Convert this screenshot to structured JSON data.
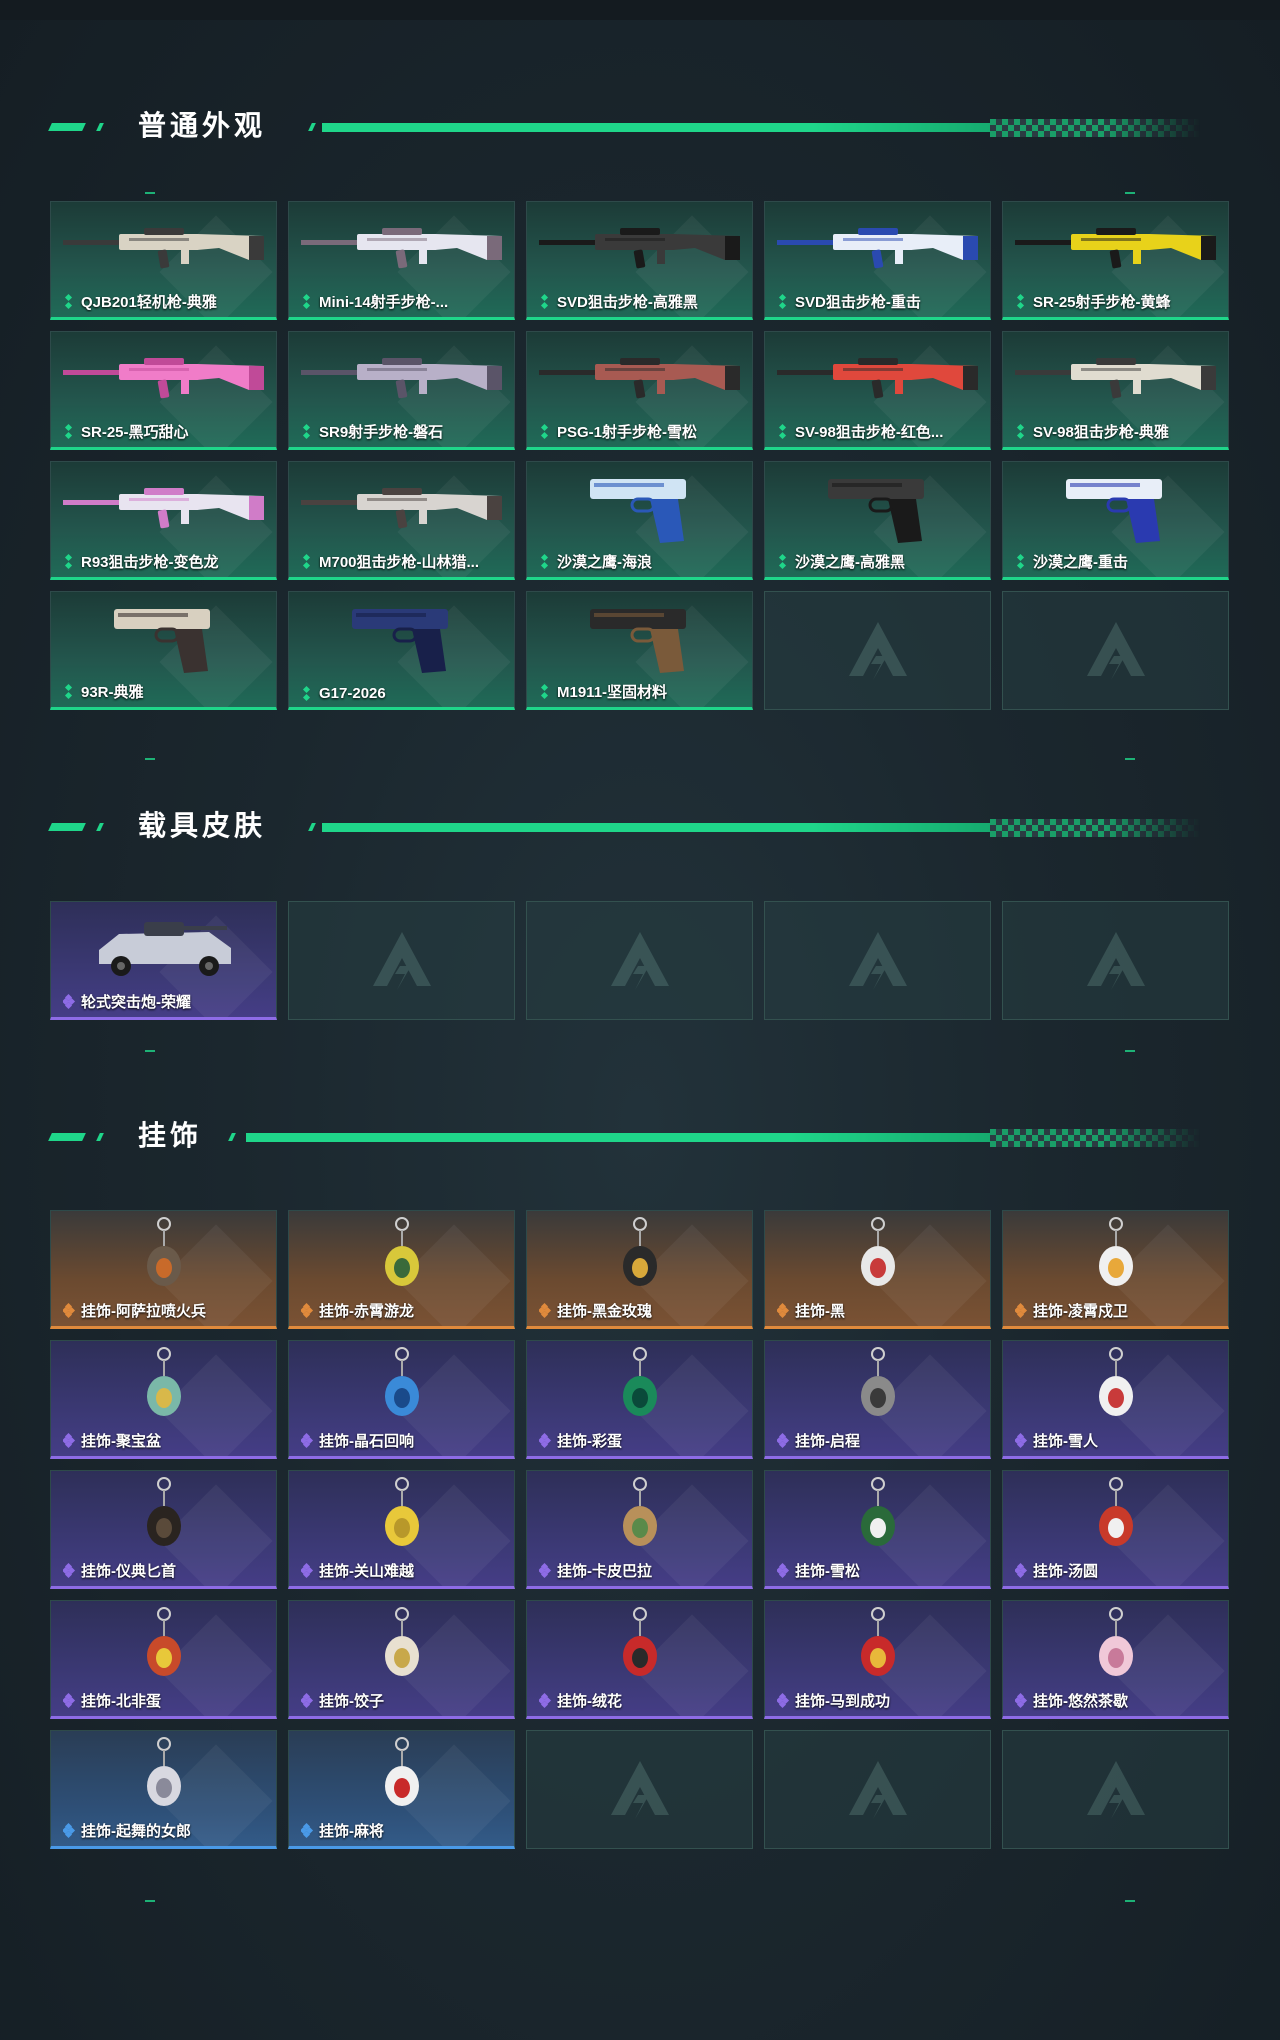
{
  "colors": {
    "accent": "#1fd68a",
    "rarity_green": "#1fd68a",
    "rarity_purple": "#8e6ce6",
    "rarity_orange": "#e08a3c",
    "rarity_blue": "#4a9ae8"
  },
  "sections": [
    {
      "title": "普通外观",
      "items": [
        {
          "label": "QJB201轻机枪-典雅",
          "rarity": "green",
          "icon": "light-machine-gun-icon",
          "art": "rifle",
          "c1": "#d9d3c4",
          "c2": "#3a3a3a"
        },
        {
          "label": "Mini-14射手步枪-...",
          "rarity": "green",
          "icon": "marksman-rifle-icon",
          "art": "rifle",
          "c1": "#e6e6f0",
          "c2": "#7a6a7a"
        },
        {
          "label": "SVD狙击步枪-高雅黑",
          "rarity": "green",
          "icon": "sniper-rifle-icon",
          "art": "rifle",
          "c1": "#3a3a3a",
          "c2": "#1a1a1a"
        },
        {
          "label": "SVD狙击步枪-重击",
          "rarity": "green",
          "icon": "sniper-rifle-icon",
          "art": "rifle",
          "c1": "#e8eef8",
          "c2": "#2a4ab0"
        },
        {
          "label": "SR-25射手步枪-黄蜂",
          "rarity": "green",
          "icon": "marksman-rifle-icon",
          "art": "rifle",
          "c1": "#e8d21a",
          "c2": "#1a1a1a"
        },
        {
          "label": "SR-25-黑巧甜心",
          "rarity": "green",
          "icon": "marksman-rifle-icon",
          "art": "rifle",
          "c1": "#f07cc8",
          "c2": "#c04a98"
        },
        {
          "label": "SR9射手步枪-磐石",
          "rarity": "green",
          "icon": "marksman-rifle-icon",
          "art": "rifle",
          "c1": "#b8b0c8",
          "c2": "#5a5468"
        },
        {
          "label": "PSG-1射手步枪-雪松",
          "rarity": "green",
          "icon": "marksman-rifle-icon",
          "art": "rifle",
          "c1": "#a85a52",
          "c2": "#2a2a2a"
        },
        {
          "label": "SV-98狙击步枪-红色...",
          "rarity": "green",
          "icon": "sniper-rifle-icon",
          "art": "rifle",
          "c1": "#e0483c",
          "c2": "#2a2a2a"
        },
        {
          "label": "SV-98狙击步枪-典雅",
          "rarity": "green",
          "icon": "sniper-rifle-icon",
          "art": "rifle",
          "c1": "#e0dcd0",
          "c2": "#3a3a3a"
        },
        {
          "label": "R93狙击步枪-变色龙",
          "rarity": "green",
          "icon": "sniper-rifle-icon",
          "art": "rifle",
          "c1": "#e8e4f0",
          "c2": "#d07cc8"
        },
        {
          "label": "M700狙击步枪-山林猎...",
          "rarity": "green",
          "icon": "sniper-rifle-icon",
          "art": "rifle",
          "c1": "#d8d4d0",
          "c2": "#4a4240"
        },
        {
          "label": "沙漠之鹰-海浪",
          "rarity": "green",
          "icon": "pistol-icon",
          "art": "pistol",
          "c1": "#d0e4f4",
          "c2": "#2a58b8"
        },
        {
          "label": "沙漠之鹰-高雅黑",
          "rarity": "green",
          "icon": "pistol-icon",
          "art": "pistol",
          "c1": "#3a3a3a",
          "c2": "#1a1a1a"
        },
        {
          "label": "沙漠之鹰-重击",
          "rarity": "green",
          "icon": "pistol-icon",
          "art": "pistol",
          "c1": "#e8eef8",
          "c2": "#2a3ab0"
        },
        {
          "label": "93R-典雅",
          "rarity": "green",
          "icon": "pistol-icon",
          "art": "pistol",
          "c1": "#d8d0c0",
          "c2": "#3a3230"
        },
        {
          "label": "G17-2026",
          "rarity": "green",
          "icon": "pistol-icon",
          "art": "pistol",
          "c1": "#2a3a78",
          "c2": "#18204a"
        },
        {
          "label": "M1911-坚固材料",
          "rarity": "green",
          "icon": "pistol-icon",
          "art": "pistol",
          "c1": "#2a2a2a",
          "c2": "#7a5a3a"
        }
      ],
      "empty_slots": 2
    },
    {
      "title": "载具皮肤",
      "items": [
        {
          "label": "轮式突击炮-荣耀",
          "rarity": "purple",
          "icon": "vehicle-icon",
          "art": "vehicle",
          "c1": "#c8ccd8",
          "c2": "#3a3e4a"
        }
      ],
      "empty_slots": 4
    },
    {
      "title": "挂饰",
      "items": [
        {
          "label": "挂饰-阿萨拉喷火兵",
          "rarity": "orange",
          "icon": "charm-icon",
          "art": "charm",
          "c1": "#6a5a4a",
          "c2": "#c86a2a"
        },
        {
          "label": "挂饰-赤霄游龙",
          "rarity": "orange",
          "icon": "charm-icon",
          "art": "charm",
          "c1": "#d8c83a",
          "c2": "#3a6a3a"
        },
        {
          "label": "挂饰-黑金玫瑰",
          "rarity": "orange",
          "icon": "charm-icon",
          "art": "charm",
          "c1": "#2a2a2a",
          "c2": "#d8a83a"
        },
        {
          "label": "挂饰-黑",
          "rarity": "orange",
          "icon": "charm-icon",
          "art": "charm",
          "c1": "#e8e8e8",
          "c2": "#c83a3a"
        },
        {
          "label": "挂饰-凌霄戍卫",
          "rarity": "orange",
          "icon": "charm-icon",
          "art": "charm",
          "c1": "#f0f0f0",
          "c2": "#e8a83a"
        },
        {
          "label": "挂饰-聚宝盆",
          "rarity": "purple",
          "icon": "charm-icon",
          "art": "charm",
          "c1": "#7ab8a8",
          "c2": "#d8b84a"
        },
        {
          "label": "挂饰-晶石回响",
          "rarity": "purple",
          "icon": "charm-icon",
          "art": "charm",
          "c1": "#3a8ad8",
          "c2": "#1a4a8a"
        },
        {
          "label": "挂饰-彩蛋",
          "rarity": "purple",
          "icon": "charm-icon",
          "art": "charm",
          "c1": "#1a8a5a",
          "c2": "#0a4a3a"
        },
        {
          "label": "挂饰-启程",
          "rarity": "purple",
          "icon": "charm-icon",
          "art": "charm",
          "c1": "#8a8a8a",
          "c2": "#3a3a3a"
        },
        {
          "label": "挂饰-雪人",
          "rarity": "purple",
          "icon": "charm-icon",
          "art": "charm",
          "c1": "#f0f0f0",
          "c2": "#c83a3a"
        },
        {
          "label": "挂饰-仪典匕首",
          "rarity": "purple",
          "icon": "charm-icon",
          "art": "charm",
          "c1": "#2a2420",
          "c2": "#5a4a3a"
        },
        {
          "label": "挂饰-关山难越",
          "rarity": "purple",
          "icon": "charm-icon",
          "art": "charm",
          "c1": "#e8c83a",
          "c2": "#b8982a"
        },
        {
          "label": "挂饰-卡皮巴拉",
          "rarity": "purple",
          "icon": "charm-icon",
          "art": "charm",
          "c1": "#b8905a",
          "c2": "#5a8a4a"
        },
        {
          "label": "挂饰-雪松",
          "rarity": "purple",
          "icon": "charm-icon",
          "art": "charm",
          "c1": "#2a6a3a",
          "c2": "#f0f0f0"
        },
        {
          "label": "挂饰-汤圆",
          "rarity": "purple",
          "icon": "charm-icon",
          "art": "charm",
          "c1": "#c83a2a",
          "c2": "#f0f0f0"
        },
        {
          "label": "挂饰-北非蛋",
          "rarity": "purple",
          "icon": "charm-icon",
          "art": "charm",
          "c1": "#c84a2a",
          "c2": "#e8c83a"
        },
        {
          "label": "挂饰-饺子",
          "rarity": "purple",
          "icon": "charm-icon",
          "art": "charm",
          "c1": "#e8e0d0",
          "c2": "#c8a84a"
        },
        {
          "label": "挂饰-绒花",
          "rarity": "purple",
          "icon": "charm-icon",
          "art": "charm",
          "c1": "#c82a2a",
          "c2": "#2a2a2a"
        },
        {
          "label": "挂饰-马到成功",
          "rarity": "purple",
          "icon": "charm-icon",
          "art": "charm",
          "c1": "#c82a2a",
          "c2": "#e8b83a"
        },
        {
          "label": "挂饰-悠然茶歇",
          "rarity": "purple",
          "icon": "charm-icon",
          "art": "charm",
          "c1": "#f0c8d8",
          "c2": "#c87a9a"
        },
        {
          "label": "挂饰-起舞的女郎",
          "rarity": "blue",
          "icon": "charm-icon",
          "art": "charm",
          "c1": "#d8d8e0",
          "c2": "#8a8a9a"
        },
        {
          "label": "挂饰-麻将",
          "rarity": "blue",
          "icon": "charm-icon",
          "art": "charm",
          "c1": "#f0f0f0",
          "c2": "#c82a2a"
        }
      ],
      "empty_slots": 3
    }
  ]
}
